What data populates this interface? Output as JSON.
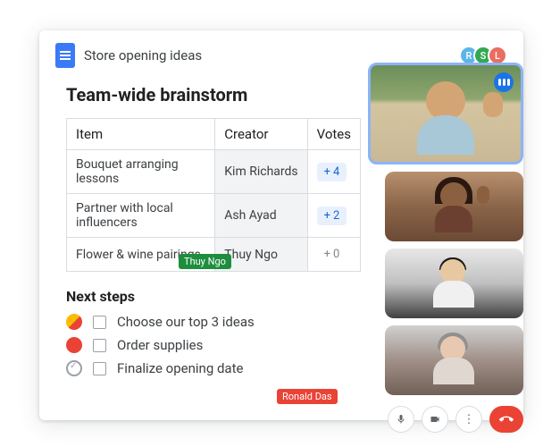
{
  "doc": {
    "title": "Store opening ideas"
  },
  "collaborators": [
    {
      "initial": "R",
      "cls": "av-r"
    },
    {
      "initial": "S",
      "cls": "av-s"
    },
    {
      "initial": "L",
      "cls": "av-l"
    }
  ],
  "heading": "Team-wide brainstorm",
  "table": {
    "headers": {
      "item": "Item",
      "creator": "Creator",
      "votes": "Votes"
    },
    "rows": [
      {
        "item": "Bouquet arranging lessons",
        "creator": "Kim Richards",
        "votes": "4",
        "style": "vote-blue"
      },
      {
        "item": "Partner with local influencers",
        "creator": "Ash Ayad",
        "votes": "2",
        "style": "vote-blue"
      },
      {
        "item": "Flower & wine pairings",
        "creator": "Thuy Ngo",
        "votes": "0",
        "style": "vote-gray"
      }
    ]
  },
  "cursors": {
    "thuy": "Thuy Ngo",
    "ronald": "Ronald Das"
  },
  "next": {
    "heading": "Next steps",
    "items": [
      "Choose our top 3 ideas",
      "Order supplies",
      "Finalize opening date"
    ]
  },
  "controls": {
    "mic": "🎤",
    "cam": "📹",
    "more": "⋮",
    "hang": "📞"
  }
}
